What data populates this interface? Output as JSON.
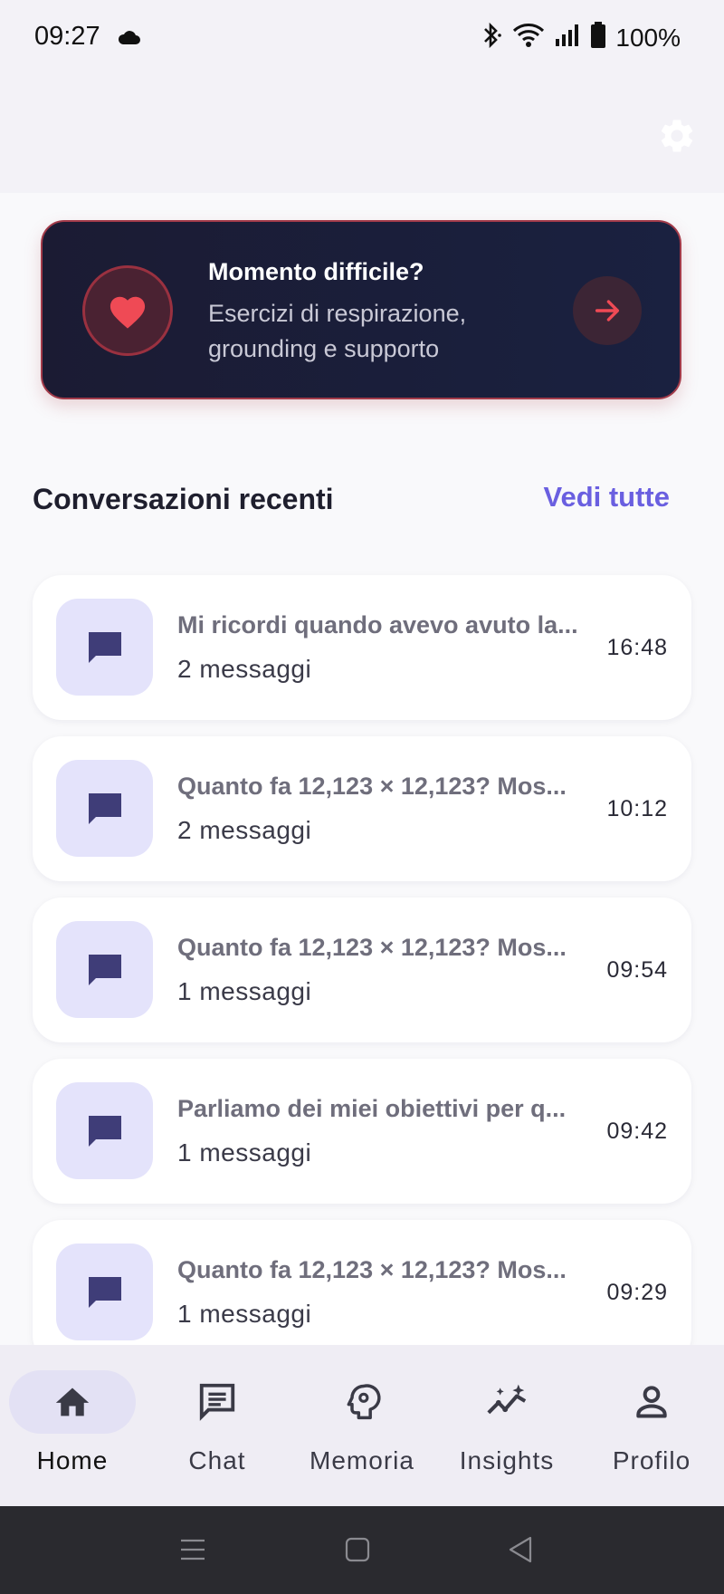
{
  "status_bar": {
    "time": "09:27",
    "battery": "100%",
    "icons": [
      "cloud-icon",
      "bluetooth-icon",
      "wifi-icon",
      "signal-icon",
      "battery-icon"
    ]
  },
  "header": {
    "settings_icon": "gear-icon"
  },
  "support_card": {
    "title": "Momento difficile?",
    "subtitle": "Esercizi di respirazione, grounding e supporto",
    "icon": "heart-icon",
    "action_icon": "arrow-right-icon"
  },
  "recent": {
    "title": "Conversazioni recenti",
    "see_all": "Vedi tutte",
    "items": [
      {
        "title": "Mi ricordi quando avevo avuto la...",
        "count": "2 messaggi",
        "time": "16:48"
      },
      {
        "title": "Quanto fa 12,123 × 12,123? Mos...",
        "count": "2 messaggi",
        "time": "10:12"
      },
      {
        "title": "Quanto fa 12,123 × 12,123? Mos...",
        "count": "1 messaggi",
        "time": "09:54"
      },
      {
        "title": "Parliamo dei miei obiettivi per q...",
        "count": "1 messaggi",
        "time": "09:42"
      },
      {
        "title": "Quanto fa 12,123 × 12,123? Mos...",
        "count": "1 messaggi",
        "time": "09:29"
      }
    ]
  },
  "nav": {
    "items": [
      {
        "label": "Home",
        "icon": "home-icon",
        "active": true
      },
      {
        "label": "Chat",
        "icon": "chat-icon",
        "active": false
      },
      {
        "label": "Memoria",
        "icon": "brain-icon",
        "active": false
      },
      {
        "label": "Insights",
        "icon": "insights-icon",
        "active": false
      },
      {
        "label": "Profilo",
        "icon": "person-icon",
        "active": false
      }
    ]
  },
  "colors": {
    "accent": "#6a5fe0",
    "card_dark": "#1b1b33",
    "heart": "#ef4a55",
    "icon_tile": "#e4e3fb",
    "icon_fill": "#3f3d78"
  }
}
